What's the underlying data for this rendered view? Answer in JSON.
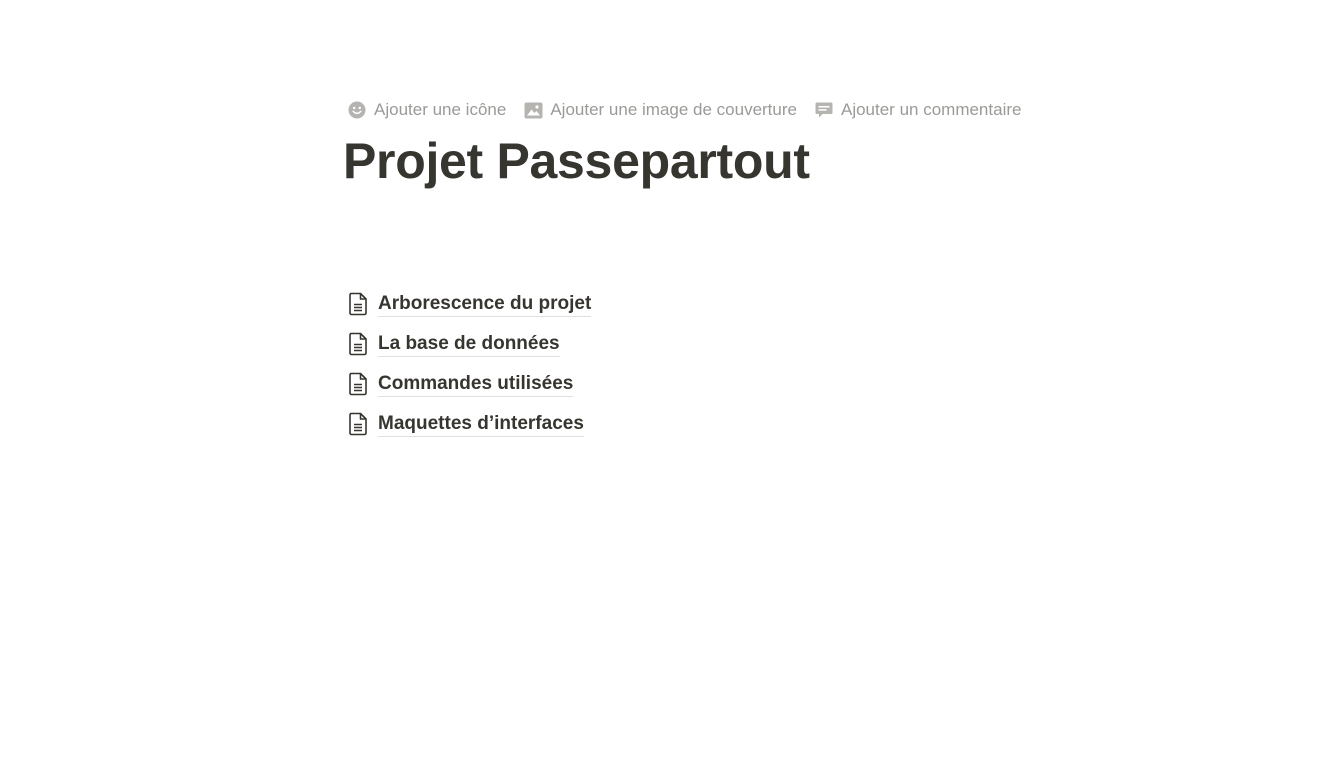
{
  "controls": [
    {
      "label": "Ajouter une icône",
      "icon": "emoji-smile-icon"
    },
    {
      "label": "Ajouter une image de couverture",
      "icon": "image-icon"
    },
    {
      "label": "Ajouter un commentaire",
      "icon": "comment-icon"
    }
  ],
  "page": {
    "title": "Projet Passepartout"
  },
  "subpages": [
    {
      "label": "Arborescence du projet",
      "icon": "document-icon"
    },
    {
      "label": "La base de données",
      "icon": "document-icon"
    },
    {
      "label": "Commandes utilisées",
      "icon": "document-icon"
    },
    {
      "label": "Maquettes d’interfaces",
      "icon": "document-icon"
    }
  ],
  "colors": {
    "text": "#37352f",
    "muted": "#9b9a97",
    "background": "#ffffff"
  }
}
